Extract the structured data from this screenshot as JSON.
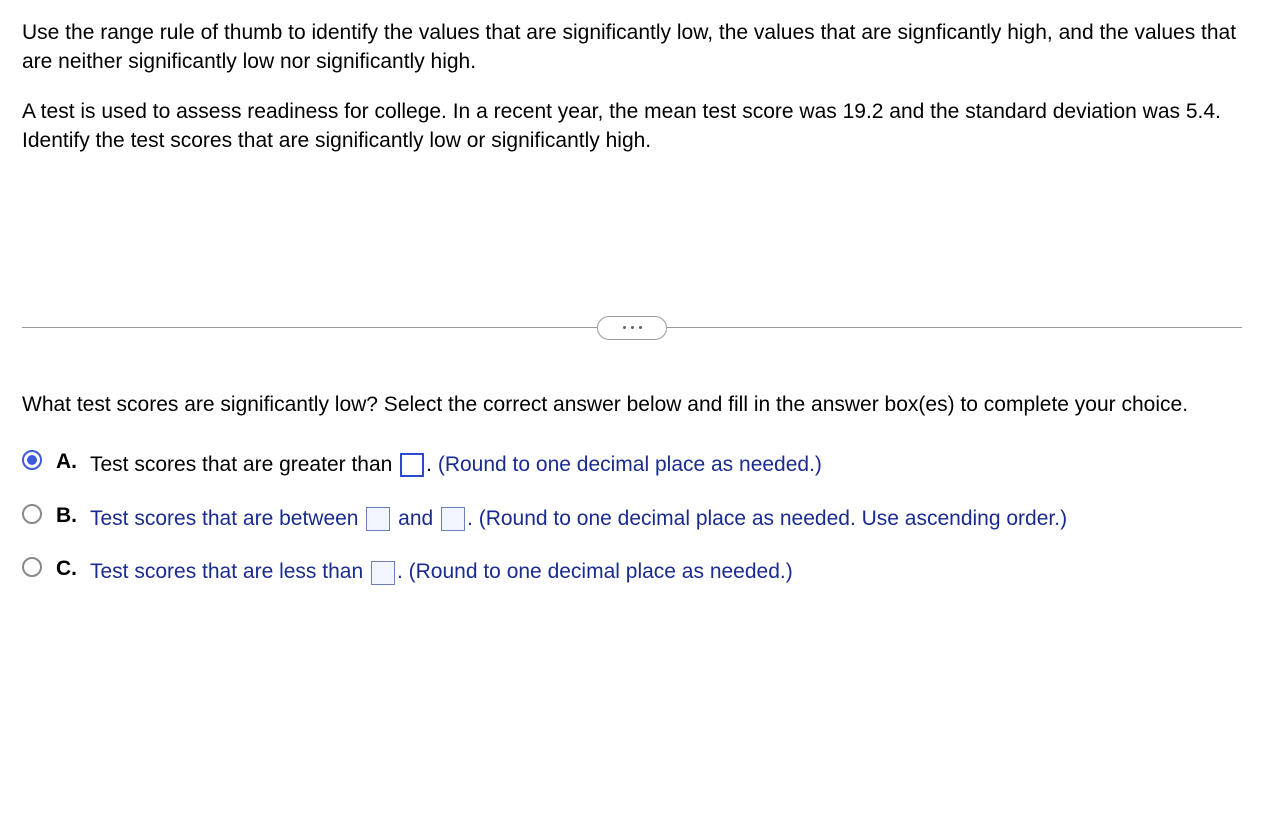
{
  "question": {
    "intro": "Use the range rule of thumb to identify the values that are significantly low, the values that are signficantly high, and the values that are neither significantly low nor significantly high.",
    "scenario": "A test is used to assess readiness for college. In a recent year, the mean test score was 19.2 and the standard deviation was 5.4. Identify the test scores that are significantly low or significantly high."
  },
  "prompt": "What test scores are significantly low? Select the correct answer below and fill in the answer box(es) to complete your choice.",
  "options": {
    "a": {
      "letter": "A.",
      "text_before": "Test scores that are greater than ",
      "text_after": ". ",
      "hint": "(Round to one decimal place as needed.)",
      "selected": true
    },
    "b": {
      "letter": "B.",
      "text_before": "Test scores that are between ",
      "text_mid": " and ",
      "text_after": ". ",
      "hint": "(Round to one decimal place as needed. Use ascending order.)",
      "selected": false
    },
    "c": {
      "letter": "C.",
      "text_before": "Test scores that are less than ",
      "text_after": ". ",
      "hint": "(Round to one decimal place as needed.)",
      "selected": false
    }
  }
}
